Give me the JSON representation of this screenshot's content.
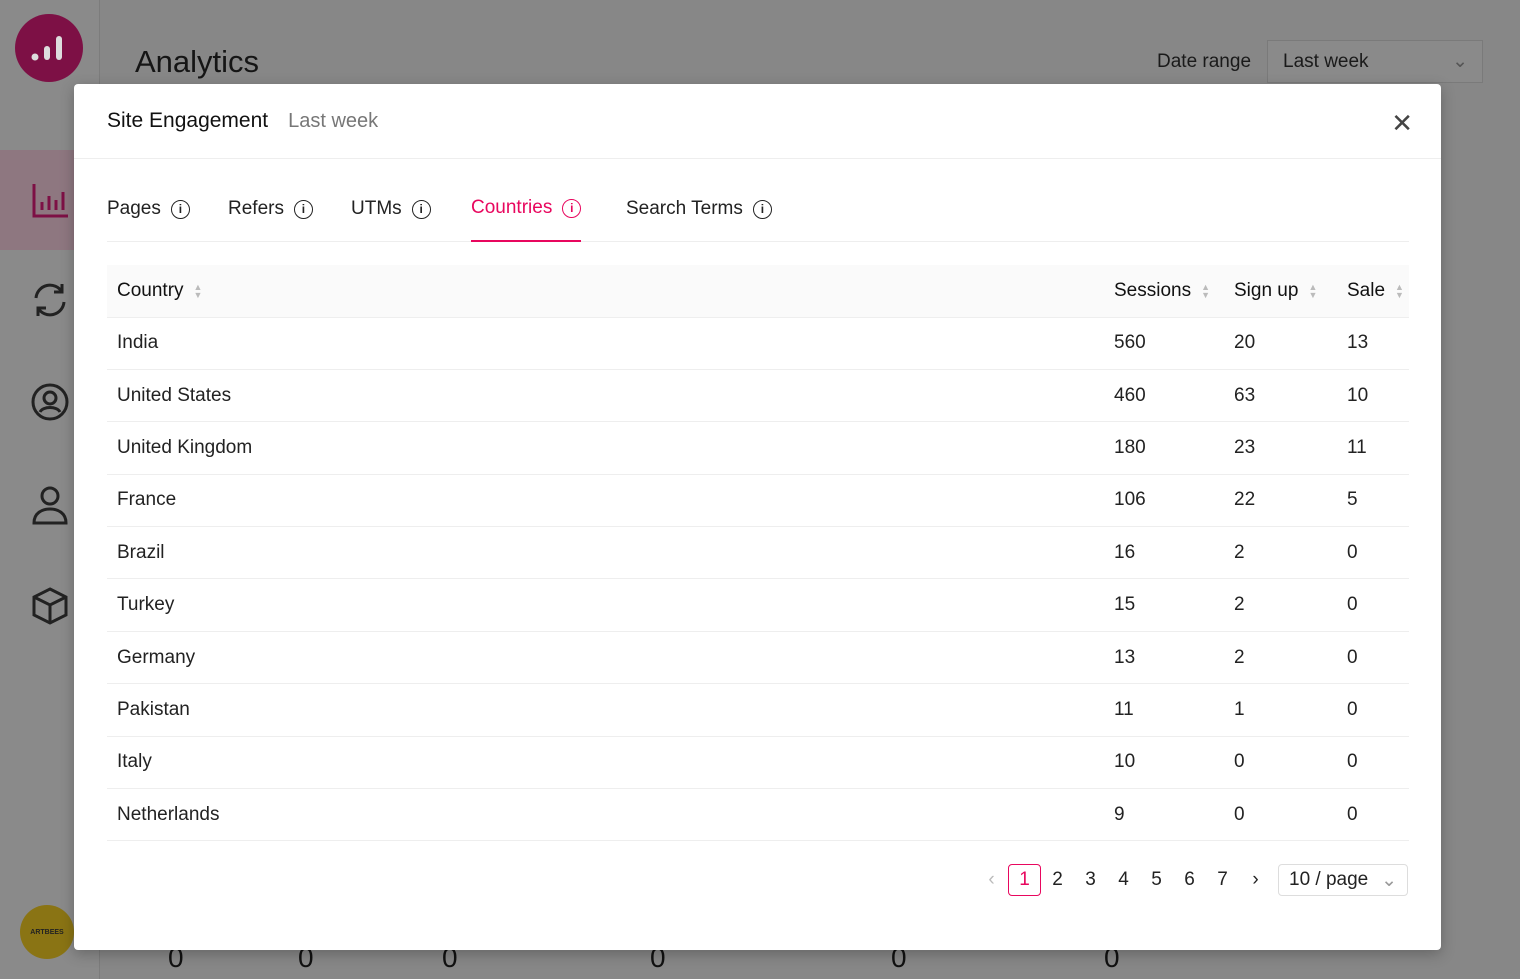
{
  "app": {
    "title": "Analytics",
    "date_range_label": "Date range",
    "date_range_value": "Last week",
    "avatar_text": "ARTBEES"
  },
  "background_zeros": [
    "0",
    "0",
    "0",
    "0",
    "0",
    "0"
  ],
  "modal": {
    "title": "Site Engagement",
    "subtitle": "Last week",
    "tabs": [
      {
        "label": "Pages"
      },
      {
        "label": "Refers"
      },
      {
        "label": "UTMs"
      },
      {
        "label": "Countries",
        "active": true
      },
      {
        "label": "Search Terms"
      }
    ],
    "columns": [
      "Country",
      "Sessions",
      "Sign up",
      "Sale"
    ],
    "rows": [
      [
        "India",
        "560",
        "20",
        "13"
      ],
      [
        "United States",
        "460",
        "63",
        "10"
      ],
      [
        "United Kingdom",
        "180",
        "23",
        "11"
      ],
      [
        "France",
        "106",
        "22",
        "5"
      ],
      [
        "Brazil",
        "16",
        "2",
        "0"
      ],
      [
        "Turkey",
        "15",
        "2",
        "0"
      ],
      [
        "Germany",
        "13",
        "2",
        "0"
      ],
      [
        "Pakistan",
        "11",
        "1",
        "0"
      ],
      [
        "Italy",
        "10",
        "0",
        "0"
      ],
      [
        "Netherlands",
        "9",
        "0",
        "0"
      ]
    ],
    "pagination": {
      "pages": [
        "1",
        "2",
        "3",
        "4",
        "5",
        "6",
        "7"
      ],
      "current": "1",
      "page_size": "10 / page"
    }
  },
  "colors": {
    "accent": "#e8075e",
    "logo": "#7d1045"
  }
}
